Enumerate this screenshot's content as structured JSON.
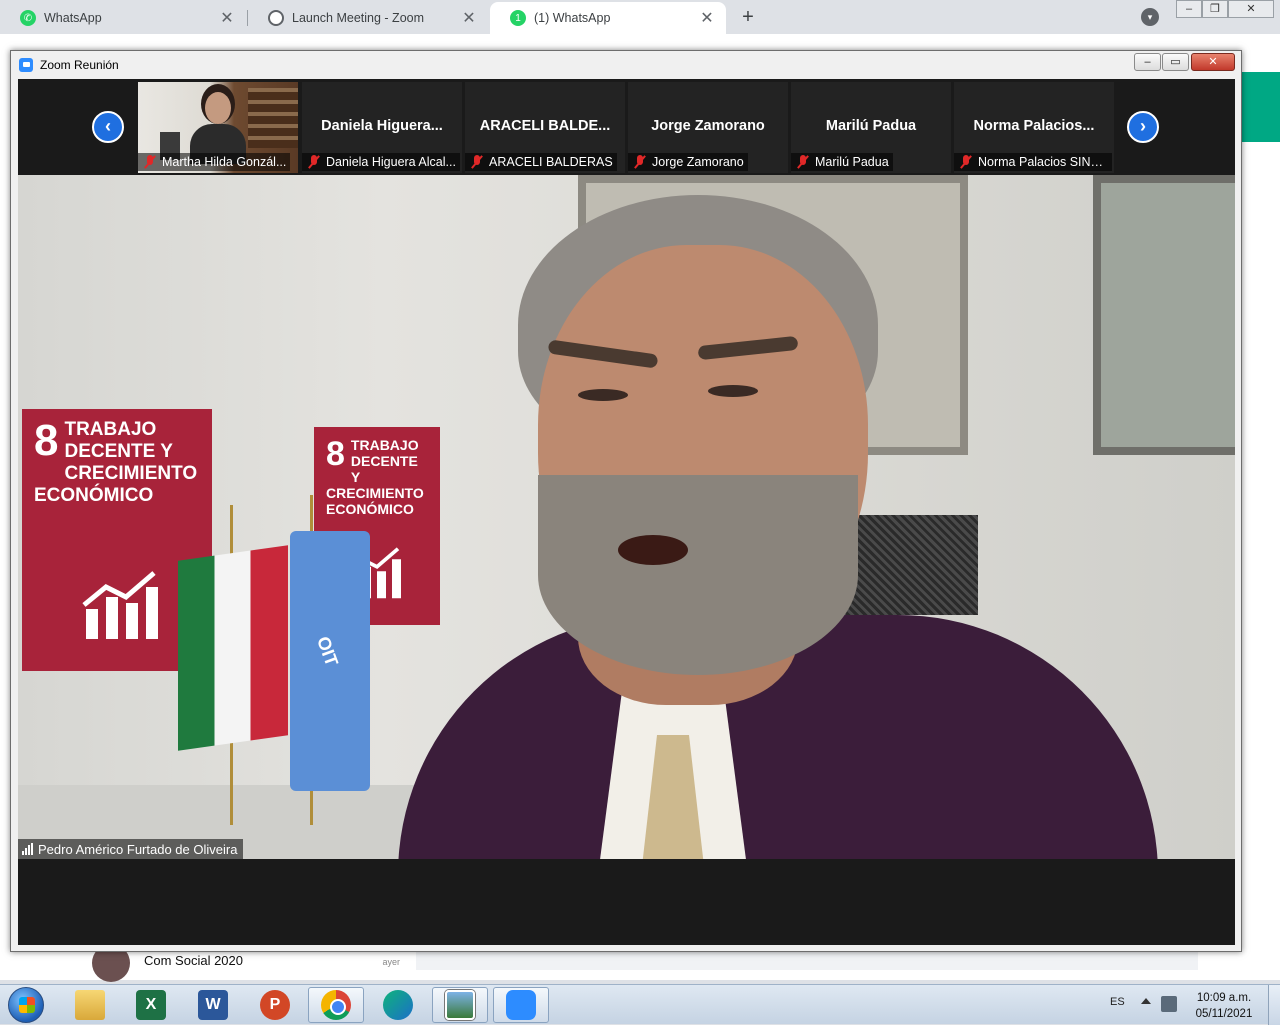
{
  "browser": {
    "tabs": [
      {
        "label": "WhatsApp",
        "icon": "whatsapp-icon",
        "active": false
      },
      {
        "label": "Launch Meeting - Zoom",
        "icon": "globe-icon",
        "active": false
      },
      {
        "label": "(1) WhatsApp",
        "icon": "whatsapp-icon",
        "active": true
      }
    ],
    "new_tab_label": "+",
    "close_glyph": "✕",
    "menu_glyph": "▾",
    "window_controls": {
      "minimize": "–",
      "restore": "❐",
      "close": "✕"
    }
  },
  "background_page": {
    "chat_name": "Com Social 2020",
    "chat_time": "ayer",
    "accent": "#00a884"
  },
  "zoom": {
    "window_title": "Zoom Reunión",
    "controls": {
      "minimize": "–",
      "restore": "▭",
      "close": "✕"
    },
    "nav_prev": "‹",
    "nav_next": "›",
    "participants": [
      {
        "display": "",
        "label": "Martha Hilda Gonzál...",
        "has_video": true
      },
      {
        "display": "Daniela  Higuera...",
        "label": "Daniela Higuera Alcal..."
      },
      {
        "display": "ARACELI  BALDE...",
        "label": "ARACELI BALDERAS"
      },
      {
        "display": "Jorge Zamorano",
        "label": "Jorge Zamorano"
      },
      {
        "display": "Marilú Padua",
        "label": "Marilú Padua"
      },
      {
        "display": "Norma  Palacios...",
        "label": "Norma Palacios SINA..."
      }
    ],
    "active_speaker": "Pedro Américo Furtado de Oliveira",
    "scene": {
      "sdg_number": "8",
      "sdg_text": "TRABAJO DECENTE Y CRECIMIENTO ECONÓMICO",
      "flag_text": "OIT",
      "sdg_color": "#a8233a"
    },
    "accent": "#2d8cff"
  },
  "taskbar": {
    "apps": [
      {
        "name": "file-explorer",
        "glyph": ""
      },
      {
        "name": "excel",
        "glyph": "X"
      },
      {
        "name": "word",
        "glyph": "W"
      },
      {
        "name": "powerpoint",
        "glyph": "P"
      },
      {
        "name": "chrome",
        "glyph": ""
      },
      {
        "name": "edge",
        "glyph": ""
      },
      {
        "name": "photos",
        "glyph": ""
      },
      {
        "name": "zoom",
        "glyph": ""
      }
    ],
    "language": "ES",
    "time": "10:09 a.m.",
    "date": "05/11/2021"
  }
}
